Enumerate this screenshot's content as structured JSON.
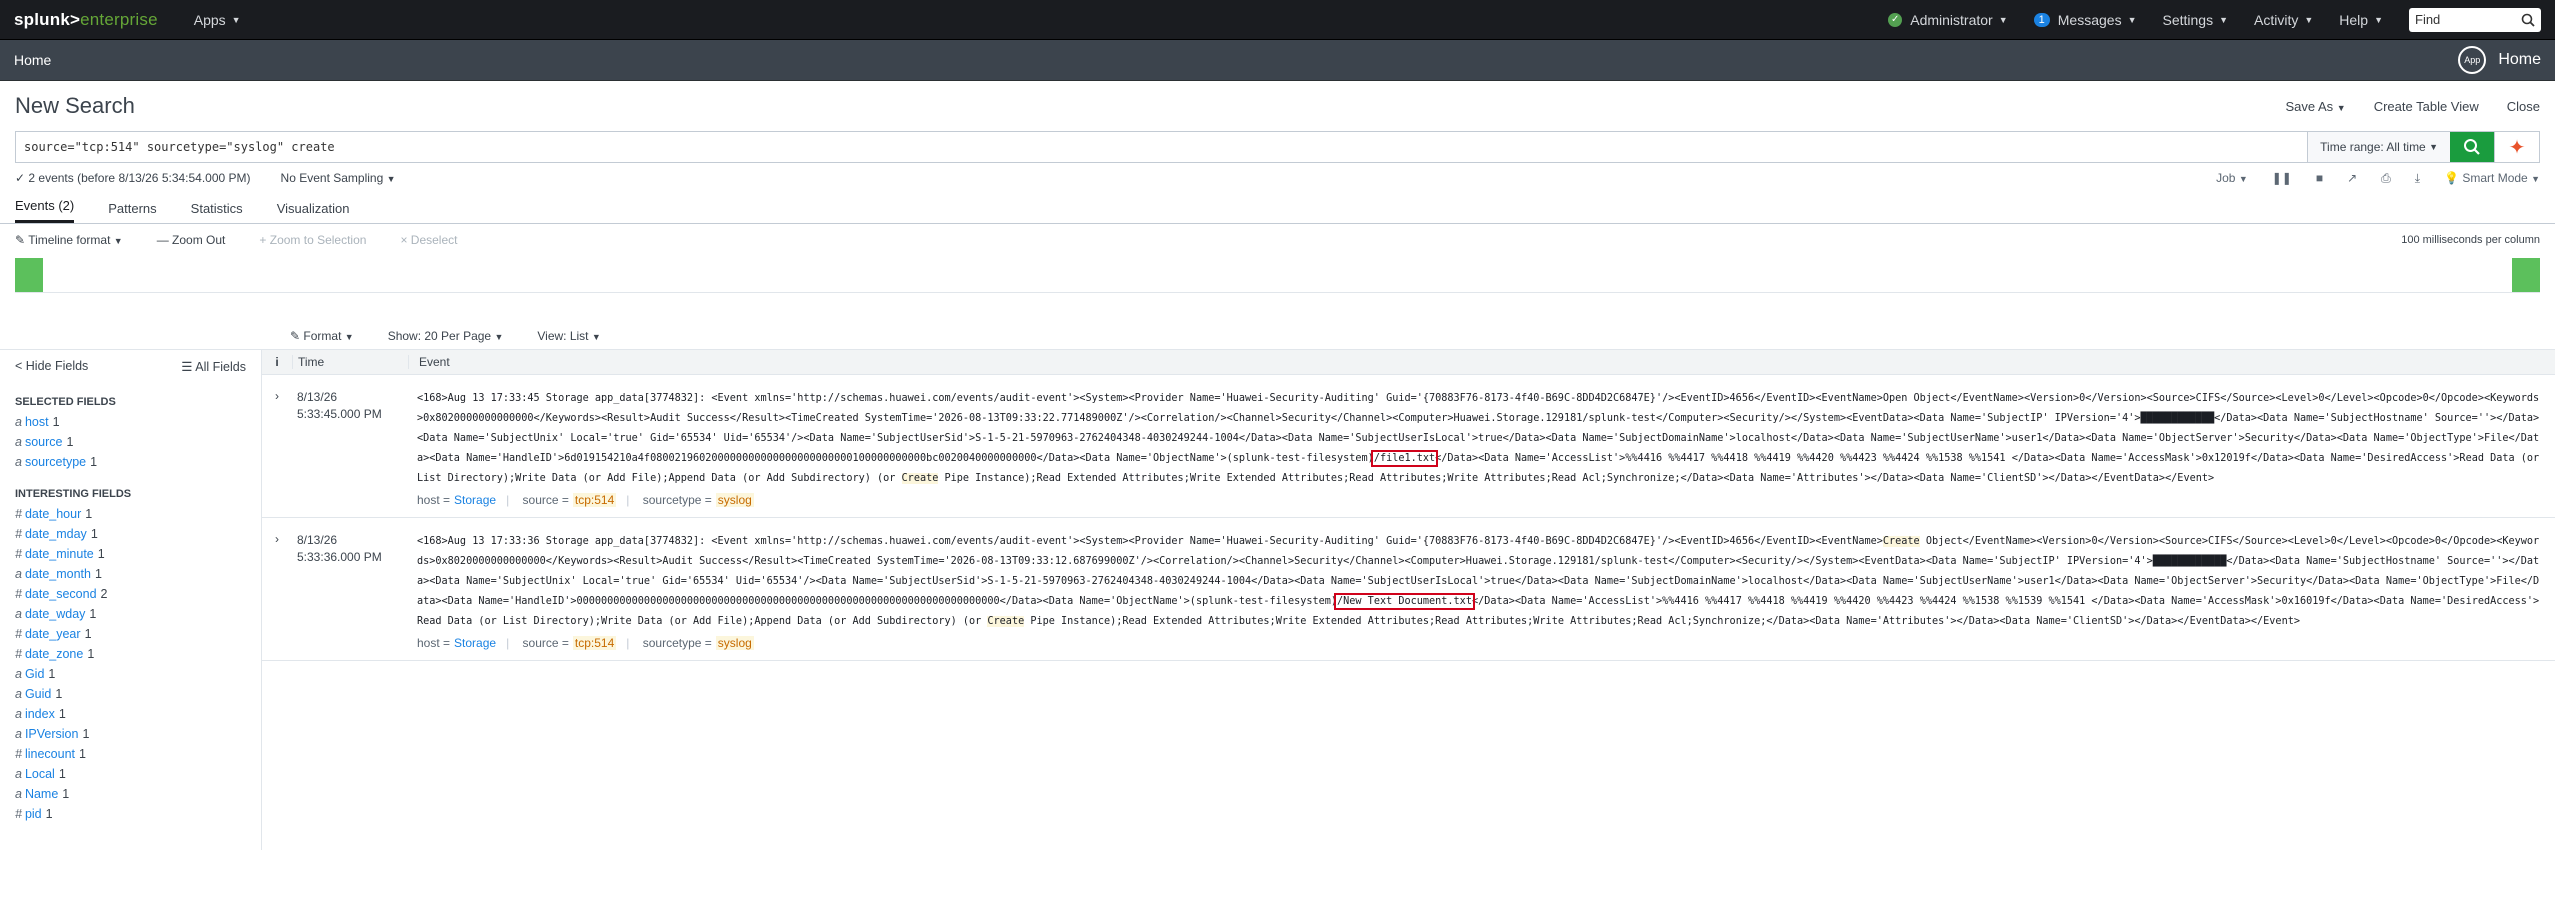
{
  "topbar": {
    "logo_main": "splunk>",
    "logo_sub": "enterprise",
    "apps": "Apps",
    "status_ok": "✓",
    "admin": "Administrator",
    "messages_count": "1",
    "messages": "Messages",
    "settings": "Settings",
    "activity": "Activity",
    "help": "Help",
    "find_placeholder": "Find"
  },
  "appbar": {
    "home": "Home",
    "app_icon": "App",
    "app_name": "Home"
  },
  "header": {
    "title": "New Search",
    "save_as": "Save As",
    "create_table": "Create Table View",
    "close": "Close"
  },
  "search": {
    "query": "source=\"tcp:514\" sourcetype=\"syslog\" create",
    "time_range": "Time range: All time"
  },
  "status": {
    "events": "✓ 2 events (before 8/13/26 5:34:54.000 PM)",
    "sampling": "No Event Sampling",
    "job": "Job",
    "smart_mode": "Smart Mode"
  },
  "tabs": [
    {
      "label": "Events (2)"
    },
    {
      "label": "Patterns"
    },
    {
      "label": "Statistics"
    },
    {
      "label": "Visualization"
    }
  ],
  "timeline": {
    "format": "Timeline format",
    "zoom_out": "— Zoom Out",
    "zoom_sel": "+ Zoom to Selection",
    "deselect": "× Deselect",
    "resolution": "100 milliseconds per column"
  },
  "format_bar": {
    "format": "Format",
    "per_page": "Show: 20 Per Page",
    "view": "View: List"
  },
  "sidebar": {
    "hide": "< Hide Fields",
    "all": "All Fields",
    "selected_heading": "SELECTED FIELDS",
    "selected": [
      {
        "type": "a",
        "name": "host",
        "count": "1"
      },
      {
        "type": "a",
        "name": "source",
        "count": "1"
      },
      {
        "type": "a",
        "name": "sourcetype",
        "count": "1"
      }
    ],
    "interesting_heading": "INTERESTING FIELDS",
    "interesting": [
      {
        "type": "#",
        "name": "date_hour",
        "count": "1"
      },
      {
        "type": "#",
        "name": "date_mday",
        "count": "1"
      },
      {
        "type": "#",
        "name": "date_minute",
        "count": "1"
      },
      {
        "type": "a",
        "name": "date_month",
        "count": "1"
      },
      {
        "type": "#",
        "name": "date_second",
        "count": "2"
      },
      {
        "type": "a",
        "name": "date_wday",
        "count": "1"
      },
      {
        "type": "#",
        "name": "date_year",
        "count": "1"
      },
      {
        "type": "#",
        "name": "date_zone",
        "count": "1"
      },
      {
        "type": "a",
        "name": "Gid",
        "count": "1"
      },
      {
        "type": "a",
        "name": "Guid",
        "count": "1"
      },
      {
        "type": "a",
        "name": "index",
        "count": "1"
      },
      {
        "type": "a",
        "name": "IPVersion",
        "count": "1"
      },
      {
        "type": "#",
        "name": "linecount",
        "count": "1"
      },
      {
        "type": "a",
        "name": "Local",
        "count": "1"
      },
      {
        "type": "a",
        "name": "Name",
        "count": "1"
      },
      {
        "type": "#",
        "name": "pid",
        "count": "1"
      }
    ]
  },
  "results": {
    "col_i": "i",
    "col_time": "Time",
    "col_event": "Event",
    "events": [
      {
        "date": "8/13/26",
        "time": "5:33:45.000 PM",
        "raw_a": "<168>Aug 13 17:33:45 Storage app_data[3774832]: <Event xmlns='http://schemas.huawei.com/events/audit-event'><System><Provider Name='Huawei-Security-Auditing' Guid='{70883F76-8173-4f40-B69C-8DD4D2C6847E}'/><EventID>4656</EventID><EventName>Open Object</EventName><Version>0</Version><Source>CIFS</Source><Level>0</Level><Opcode>0</Opcode><Keywords>0x8020000000000000</Keywords><Result>Audit Success</Result><TimeCreated SystemTime='2026-08-13T09:33:22.771489000Z'/><Correlation/><Channel>Security</Channel><Computer>Huawei.Storage.129181/splunk-test</Computer><Security/></System><EventData><Data Name='SubjectIP' IPVersion='4'>████████████</Data><Data Name='SubjectHostname' Source=''></Data><Data Name='SubjectUnix' Local='true' Gid='65534' Uid='65534'/><Data Name='SubjectUserSid'>S-1-5-21-5970963-2762404348-4030249244-1004</Data><Data Name='SubjectUserIsLocal'>true</Data><Data Name='SubjectDomainName'>localhost</Data><Data Name='SubjectUserName'>user1</Data><Data Name='ObjectServer'>Security</Data><Data Name='ObjectType'>File</Data><Data Name='HandleID'>6d019154210a4f080021960200000000000000000000000100000000000bc0020040000000000</Data><Data Name='ObjectName'>(splunk-test-filesystem)",
        "raw_box": "/file1.txt",
        "raw_b": "</Data><Data Name='AccessList'>%%4416 %%4417 %%4418 %%4419 %%4420 %%4423 %%4424 %%1538 %%1541 </Data><Data Name='AccessMask'>0x12019f</Data><Data Name='DesiredAccess'>Read Data (or List Directory);Write Data (or Add File);Append Data (or Add Subdirectory) (or ",
        "raw_hl": "Create",
        "raw_c": " Pipe Instance);Read Extended Attributes;Write Extended Attributes;Read Attributes;Write Attributes;Read Acl;Synchronize;</Data><Data Name='Attributes'></Data><Data Name='ClientSD'></Data></EventData></Event>",
        "host_label": "host =",
        "host": "Storage",
        "source_label": "source =",
        "source": "tcp:514",
        "sourcetype_label": "sourcetype =",
        "sourcetype": "syslog"
      },
      {
        "date": "8/13/26",
        "time": "5:33:36.000 PM",
        "raw_a": "<168>Aug 13 17:33:36 Storage app_data[3774832]: <Event xmlns='http://schemas.huawei.com/events/audit-event'><System><Provider Name='Huawei-Security-Auditing' Guid='{70883F76-8173-4f40-B69C-8DD4D2C6847E}'/><EventID>4656</EventID><EventName>",
        "raw_hl1": "Create",
        "raw_a2": " Object</EventName><Version>0</Version><Source>CIFS</Source><Level>0</Level><Opcode>0</Opcode><Keywords>0x8020000000000000</Keywords><Result>Audit Success</Result><TimeCreated SystemTime='2026-08-13T09:33:12.687699000Z'/><Correlation/><Channel>Security</Channel><Computer>Huawei.Storage.129181/splunk-test</Computer><Security/></System><EventData><Data Name='SubjectIP' IPVersion='4'>████████████</Data><Data Name='SubjectHostname' Source=''></Data><Data Name='SubjectUnix' Local='true' Gid='65534' Uid='65534'/><Data Name='SubjectUserSid'>S-1-5-21-5970963-2762404348-4030249244-1004</Data><Data Name='SubjectUserIsLocal'>true</Data><Data Name='SubjectDomainName'>localhost</Data><Data Name='SubjectUserName'>user1</Data><Data Name='ObjectServer'>Security</Data><Data Name='ObjectType'>File</Data><Data Name='HandleID'>000000000000000000000000000000000000000000000000000000000000000000000</Data><Data Name='ObjectName'>(splunk-test-filesystem)",
        "raw_box": "/New Text Document.txt",
        "raw_b": "</Data><Data Name='AccessList'>%%4416 %%4417 %%4418 %%4419 %%4420 %%4423 %%4424 %%1538 %%1539 %%1541 </Data><Data Name='AccessMask'>0x16019f</Data><Data Name='DesiredAccess'>Read Data (or List Directory);Write Data (or Add File);Append Data (or Add Subdirectory) (or ",
        "raw_hl": "Create",
        "raw_c": " Pipe Instance);Read Extended Attributes;Write Extended Attributes;Read Attributes;Write Attributes;Read Acl;Synchronize;</Data><Data Name='Attributes'></Data><Data Name='ClientSD'></Data></EventData></Event>",
        "host_label": "host =",
        "host": "Storage",
        "source_label": "source =",
        "source": "tcp:514",
        "sourcetype_label": "sourcetype =",
        "sourcetype": "syslog"
      }
    ]
  }
}
